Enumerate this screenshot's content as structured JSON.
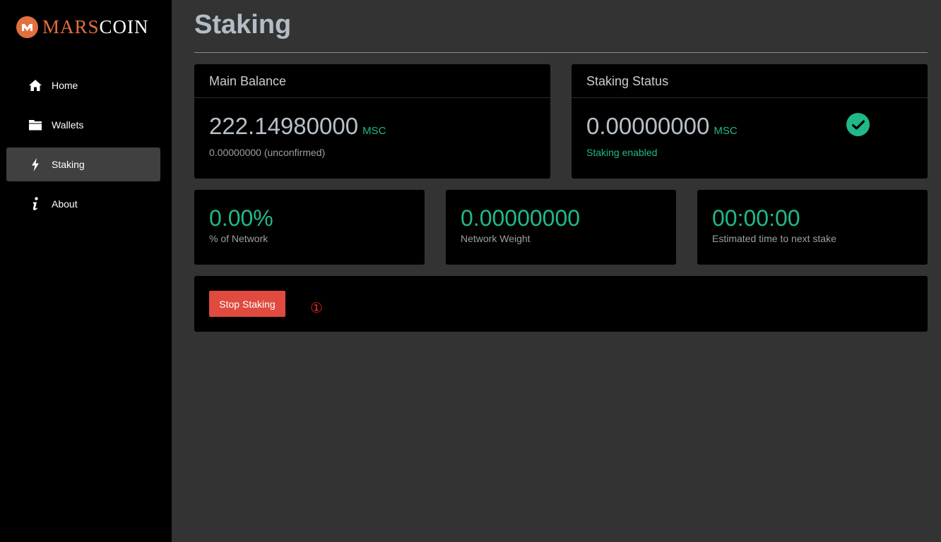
{
  "logo": {
    "part1": "MARS",
    "part2": "COIN",
    "icon": "marscoin-logo-icon"
  },
  "sidebar": {
    "items": [
      {
        "label": "Home",
        "icon": "home-icon",
        "active": false
      },
      {
        "label": "Wallets",
        "icon": "folder-icon",
        "active": false
      },
      {
        "label": "Staking",
        "icon": "lightning-icon",
        "active": true
      },
      {
        "label": "About",
        "icon": "info-icon",
        "active": false
      }
    ]
  },
  "page": {
    "title": "Staking"
  },
  "main_balance": {
    "title": "Main Balance",
    "value": "222.14980000",
    "unit": "MSC",
    "unconfirmed": "0.00000000 (unconfirmed)"
  },
  "staking_status": {
    "title": "Staking Status",
    "value": "0.00000000",
    "unit": "MSC",
    "status": "Staking enabled",
    "icon": "check-circle-icon"
  },
  "stats": [
    {
      "value": "0.00%",
      "label": "% of Network"
    },
    {
      "value": "0.00000000",
      "label": "Network Weight"
    },
    {
      "value": "00:00:00",
      "label": "Estimated time to next stake"
    }
  ],
  "actions": {
    "stop_label": "Stop Staking",
    "marker": "①"
  },
  "colors": {
    "accent_green": "#1fb98a",
    "brand_orange": "#e2703e",
    "danger_red": "#e04a3f",
    "sidebar_bg": "#000000",
    "main_bg": "#333333"
  }
}
